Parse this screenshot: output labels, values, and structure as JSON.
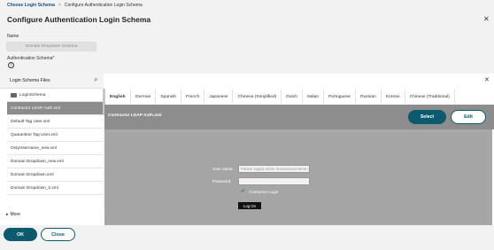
{
  "breadcrumb": {
    "parent": "Choose Login Schema",
    "separator": ">",
    "current": "Configure Authentication Login Schema"
  },
  "page": {
    "title": "Configure Authentication Login Schema",
    "close_icon": "close-icon"
  },
  "form": {
    "name_label": "Name",
    "name_placeholder": "Domain Dropdown Schema",
    "auth_schema_label": "Authentication Schema*",
    "info_icon": "info-icon"
  },
  "files_panel": {
    "title": "Login Schema Files",
    "search_icon": "search-icon",
    "folder": "LoginSchema",
    "items": [
      "Contractor LDAP Auth.xml",
      "Default Tag User.xml",
      "Quarantine Tag User.xml",
      "OnlyUsername_new.xml",
      "Domain Dropdown_new.xml",
      "Domain Dropdown.xml",
      "Domain Dropdown_2.xml"
    ],
    "selected_index": 0,
    "more_label": "More"
  },
  "language_tabs": [
    "English",
    "German",
    "Spanish",
    "French",
    "Japanese",
    "Chinese (Simplified)",
    "Dutch",
    "Italian",
    "Portuguese",
    "Russian",
    "Korean",
    "Chinese (Traditional)"
  ],
  "active_tab": "English",
  "preview": {
    "file_name": "Contractor LDAP Auth.xml",
    "select_label": "Select",
    "edit_label": "Edit",
    "user_label": "User name:",
    "user_placeholder": "Please supply either domain\\username or user@fully.qualified.domain",
    "password_label": "Password:",
    "checkbox_label": "Contractor Login",
    "login_button": "Log On"
  },
  "footer": {
    "ok_label": "OK",
    "close_label": "Close"
  },
  "colors": {
    "accent": "#0b5a6e",
    "selected_row": "#8c8c8c",
    "preview_bg": "#a8a8a8"
  }
}
